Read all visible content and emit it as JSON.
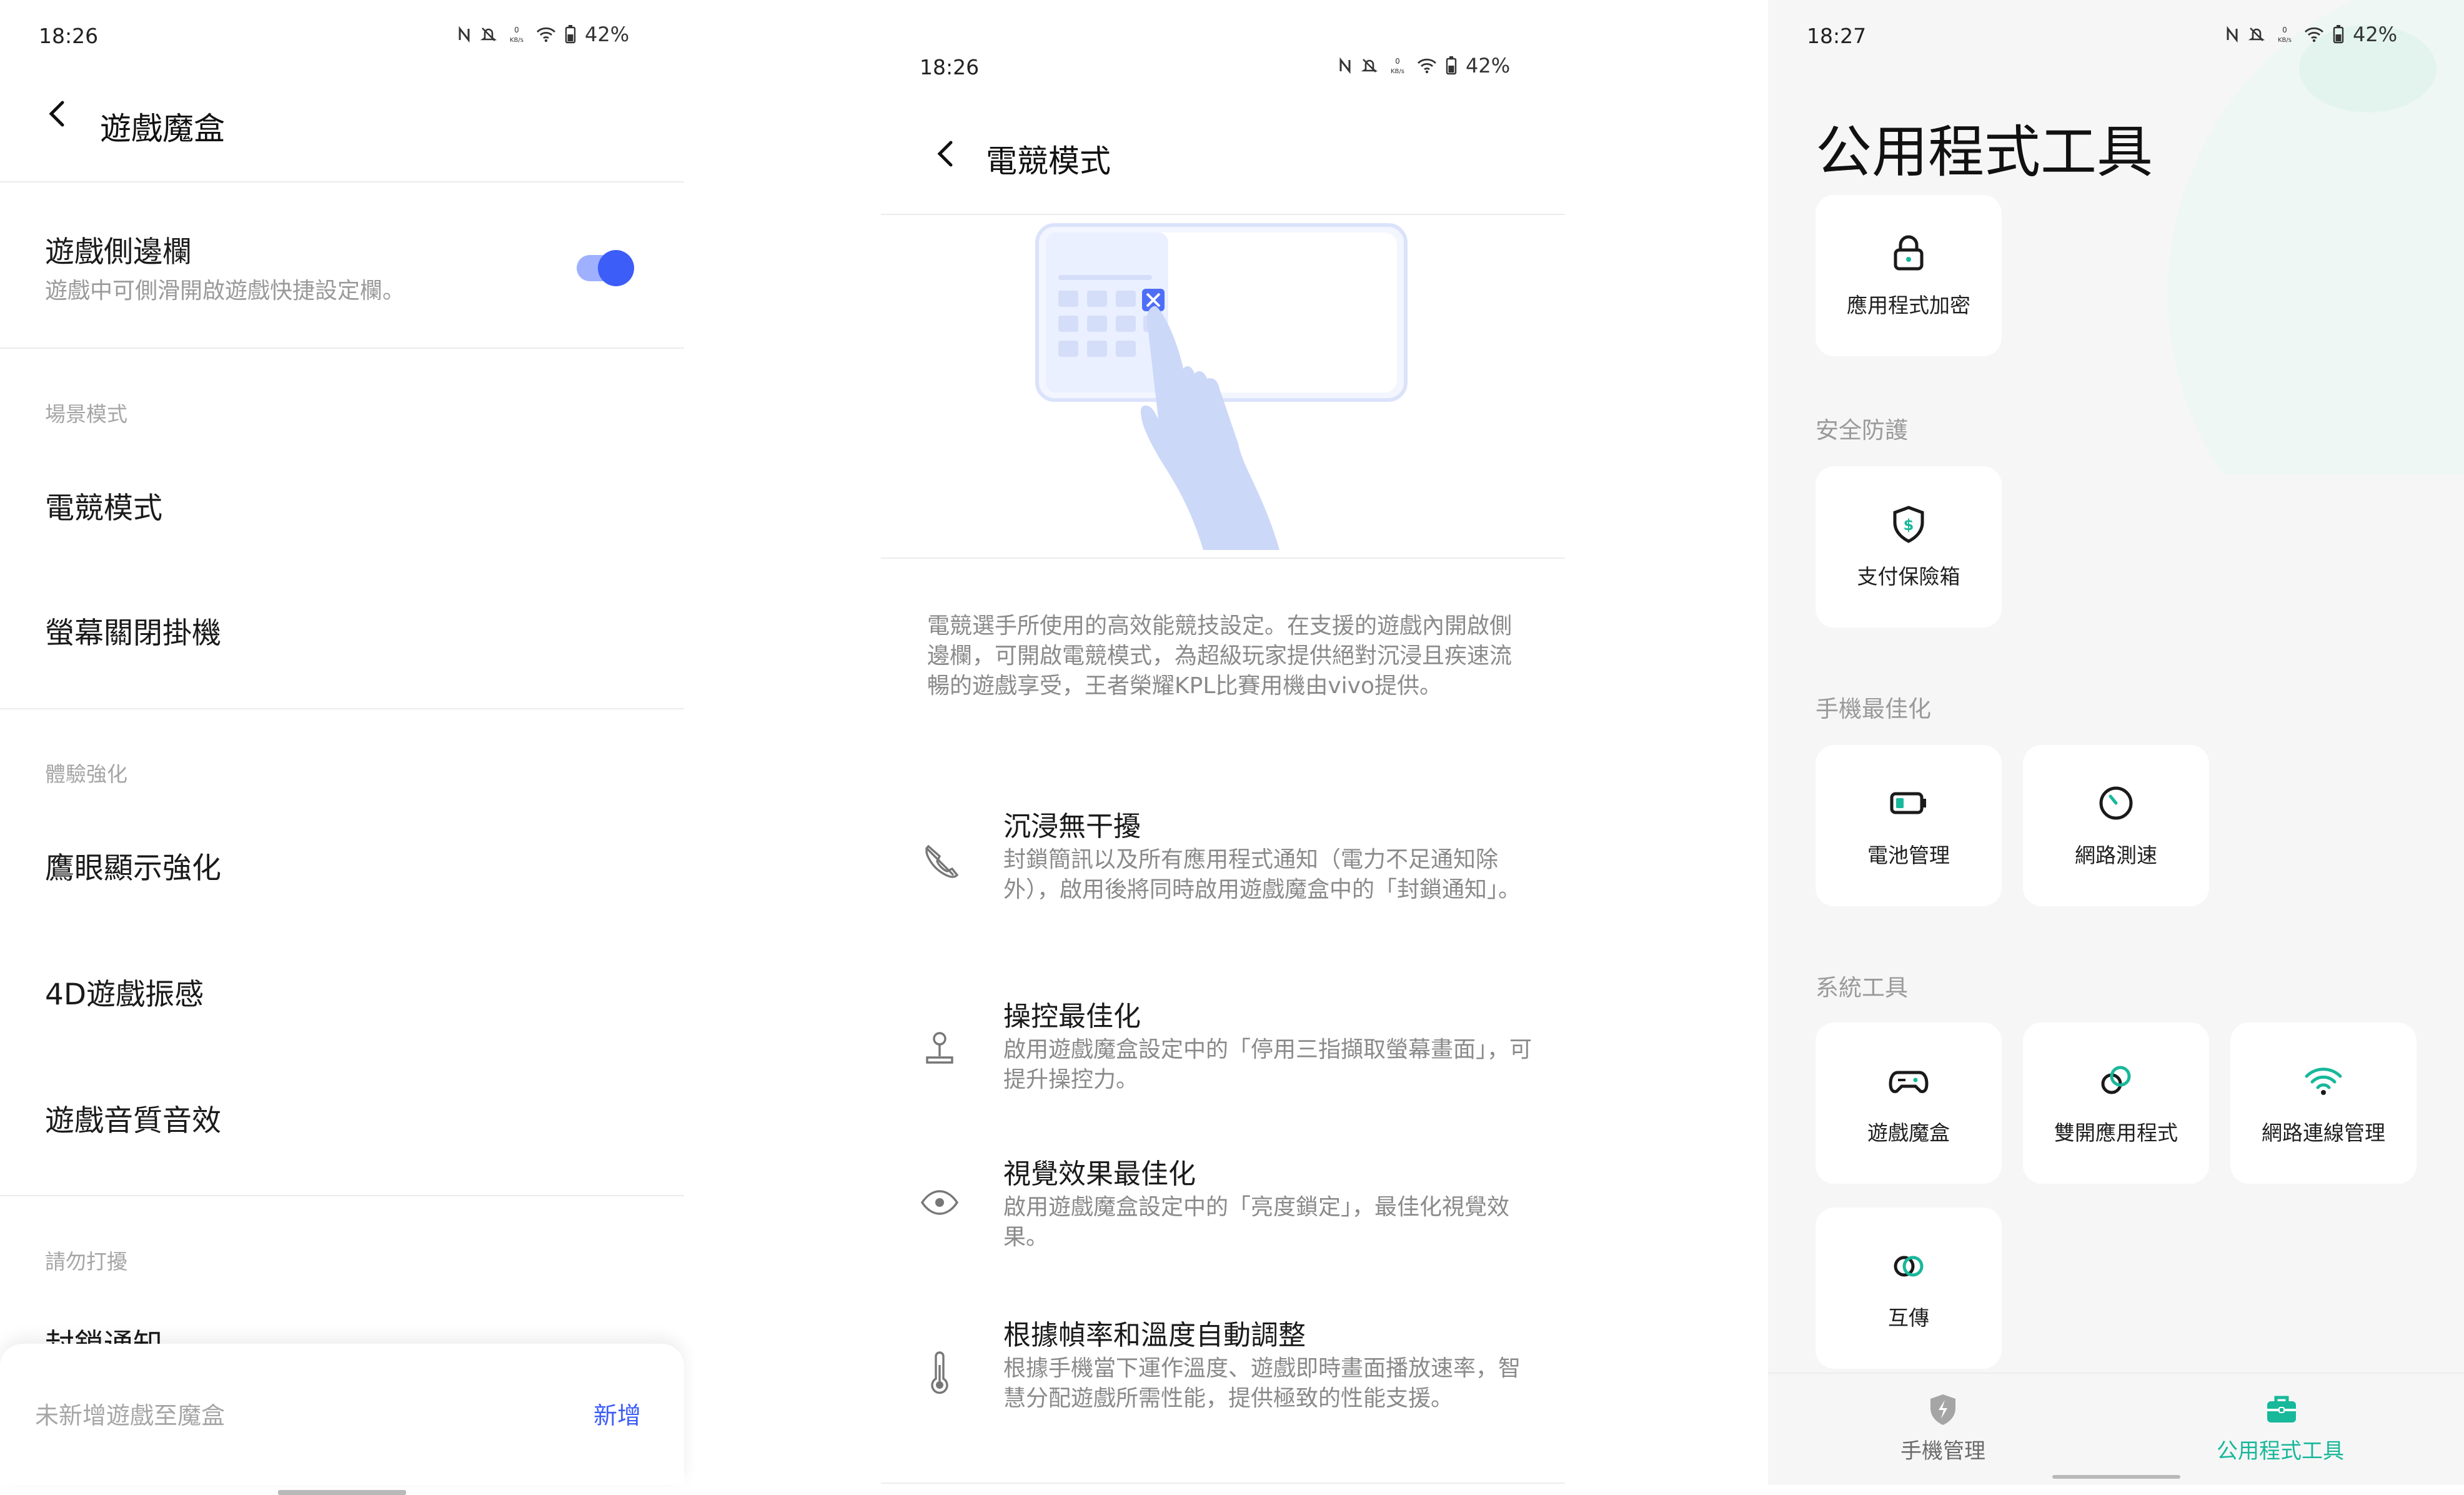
{
  "status": {
    "time1": "18:26",
    "time2": "18:26",
    "time3": "18:27",
    "battery": "42%",
    "speed": "0 KB/s"
  },
  "panel1": {
    "title": "遊戲魔盒",
    "sidebar_title": "遊戲側邊欄",
    "sidebar_sub": "遊戲中可側滑開啟遊戲快捷設定欄。",
    "sidebar_enabled": true,
    "section_scene": "場景模式",
    "scene_items": [
      "電競模式",
      "螢幕關閉掛機"
    ],
    "section_exp": "體驗強化",
    "exp_items": [
      "鷹眼顯示強化",
      "4D遊戲振感",
      "遊戲音質音效"
    ],
    "section_dnd": "請勿打擾",
    "dnd_partial": "封鎖通知",
    "sheet_text": "未新增遊戲至魔盒",
    "sheet_add": "新增"
  },
  "panel2": {
    "title": "電競模式",
    "description": "電競選手所使用的高效能競技設定。在支援的遊戲內開啟側邊欄，可開啟電競模式，為超級玩家提供絕對沉浸且疾速流暢的遊戲享受，王者榮耀KPL比賽用機由vivo提供。",
    "features": [
      {
        "title": "沉浸無干擾",
        "desc": "封鎖簡訊以及所有應用程式通知（電力不足通知除外），啟用後將同時啟用遊戲魔盒中的「封鎖通知」。",
        "icon": "phone-muted-icon"
      },
      {
        "title": "操控最佳化",
        "desc": "啟用遊戲魔盒設定中的「停用三指擷取螢幕畫面」，可提升操控力。",
        "icon": "joystick-icon"
      },
      {
        "title": "視覺效果最佳化",
        "desc": "啟用遊戲魔盒設定中的「亮度鎖定」，最佳化視覺效果。",
        "icon": "eye-icon"
      },
      {
        "title": "根據幀率和溫度自動調整",
        "desc": "根據手機當下運作溫度、遊戲即時畫面播放速率，智慧分配遊戲所需性能，提供極致的性能支援。",
        "icon": "thermometer-icon"
      }
    ]
  },
  "panel3": {
    "title": "公用程式工具",
    "top_tile": "應用程式加密",
    "section_security": "安全防護",
    "security_tiles": [
      "支付保險箱"
    ],
    "section_optimize": "手機最佳化",
    "optimize_tiles": [
      "電池管理",
      "網路測速"
    ],
    "section_system": "系統工具",
    "system_tiles": [
      "遊戲魔盒",
      "雙開應用程式",
      "網路連線管理",
      "互傳"
    ],
    "nav": {
      "manage": "手機管理",
      "tools": "公用程式工具"
    },
    "colors": {
      "accent": "#18b89a",
      "toggle": "#3c5df8",
      "link": "#3c5df8"
    }
  }
}
